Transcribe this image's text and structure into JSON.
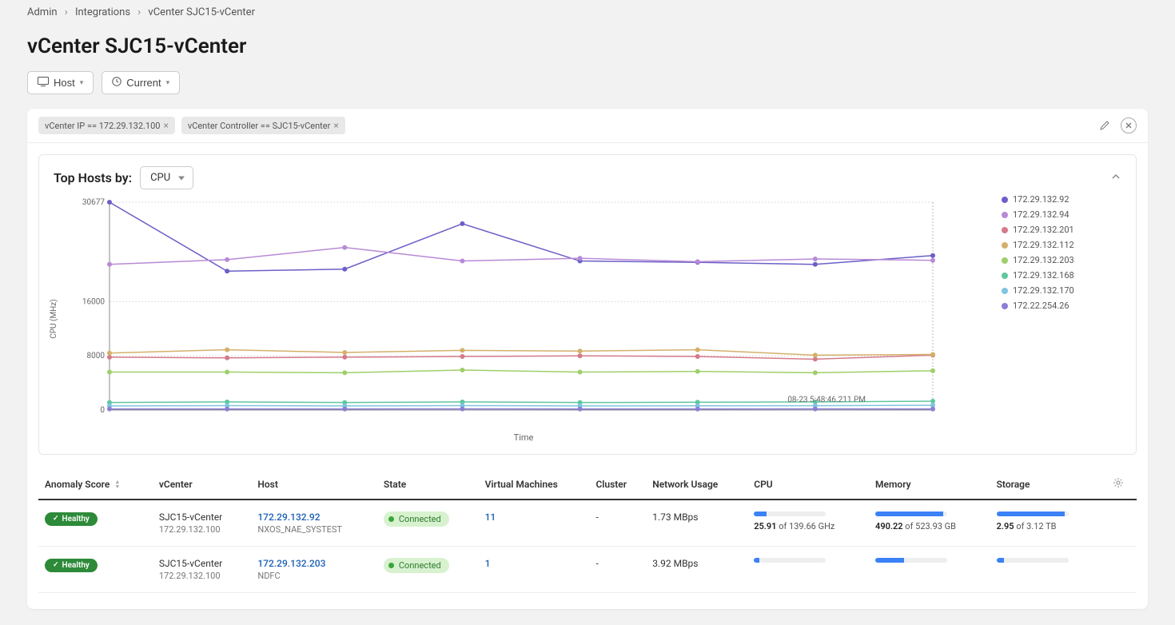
{
  "breadcrumb": [
    "Admin",
    "Integrations",
    "vCenter SJC15-vCenter"
  ],
  "page_title": "vCenter SJC15-vCenter",
  "toolbar": {
    "scope_label": "Host",
    "time_label": "Current"
  },
  "filters": [
    {
      "label": "vCenter IP == 172.29.132.100"
    },
    {
      "label": "vCenter Controller == SJC15-vCenter"
    }
  ],
  "chart": {
    "group_label": "Top Hosts by:",
    "metric_selected": "CPU",
    "y_label": "CPU (MHz)",
    "x_label": "Time",
    "timestamp_label": "08-23 5:48:46.211 PM"
  },
  "chart_data": {
    "type": "line",
    "xlabel": "Time",
    "ylabel": "CPU (MHz)",
    "ylim": [
      0,
      30677
    ],
    "yticks": [
      0,
      8000,
      16000,
      30677
    ],
    "x": [
      0,
      1,
      2,
      3,
      4,
      5,
      6,
      7
    ],
    "series": [
      {
        "name": "172.29.132.92",
        "color": "#6b5fc7",
        "values": [
          30677,
          20500,
          20800,
          27500,
          22000,
          21800,
          21500,
          22800
        ]
      },
      {
        "name": "172.29.132.94",
        "color": "#b78ad6",
        "values": [
          21500,
          22200,
          24000,
          22000,
          22400,
          21900,
          22300,
          22100
        ]
      },
      {
        "name": "172.29.132.201",
        "color": "#d47a8a",
        "values": [
          7800,
          7700,
          7800,
          7900,
          8000,
          7900,
          7500,
          8100
        ]
      },
      {
        "name": "172.29.132.112",
        "color": "#d4b06a",
        "values": [
          8400,
          8900,
          8500,
          8800,
          8700,
          8900,
          8100,
          8200
        ]
      },
      {
        "name": "172.29.132.203",
        "color": "#9ecf6a",
        "values": [
          5600,
          5600,
          5500,
          5900,
          5600,
          5700,
          5500,
          5800
        ]
      },
      {
        "name": "172.29.132.168",
        "color": "#5fc7a0",
        "values": [
          1100,
          1200,
          1100,
          1200,
          1100,
          1150,
          1200,
          1300
        ]
      },
      {
        "name": "172.29.132.170",
        "color": "#7fc4e0",
        "values": [
          600,
          650,
          600,
          650,
          600,
          620,
          640,
          700
        ]
      },
      {
        "name": "172.22.254.26",
        "color": "#8a7fd6",
        "values": [
          150,
          150,
          150,
          160,
          150,
          150,
          160,
          150
        ]
      }
    ]
  },
  "table": {
    "columns": [
      "Anomaly Score",
      "vCenter",
      "Host",
      "State",
      "Virtual Machines",
      "Cluster",
      "Network Usage",
      "CPU",
      "Memory",
      "Storage"
    ],
    "rows": [
      {
        "anomaly": "Healthy",
        "vcenter_name": "SJC15-vCenter",
        "vcenter_ip": "172.29.132.100",
        "host_ip": "172.29.132.92",
        "host_name": "NXOS_NAE_SYSTEST",
        "state": "Connected",
        "vms": "11",
        "cluster": "-",
        "net": "1.73 MBps",
        "cpu_used": "25.91",
        "cpu_total": "139.66 GHz",
        "cpu_pct": 18,
        "mem_used": "490.22",
        "mem_total": "523.93 GB",
        "mem_pct": 94,
        "sto_used": "2.95",
        "sto_total": "3.12 TB",
        "sto_pct": 95
      },
      {
        "anomaly": "Healthy",
        "vcenter_name": "SJC15-vCenter",
        "vcenter_ip": "172.29.132.100",
        "host_ip": "172.29.132.203",
        "host_name": "NDFC",
        "state": "Connected",
        "vms": "1",
        "cluster": "-",
        "net": "3.92 MBps",
        "cpu_used": "",
        "cpu_total": "",
        "cpu_pct": 8,
        "mem_used": "",
        "mem_total": "",
        "mem_pct": 40,
        "sto_used": "",
        "sto_total": "",
        "sto_pct": 10
      }
    ]
  }
}
